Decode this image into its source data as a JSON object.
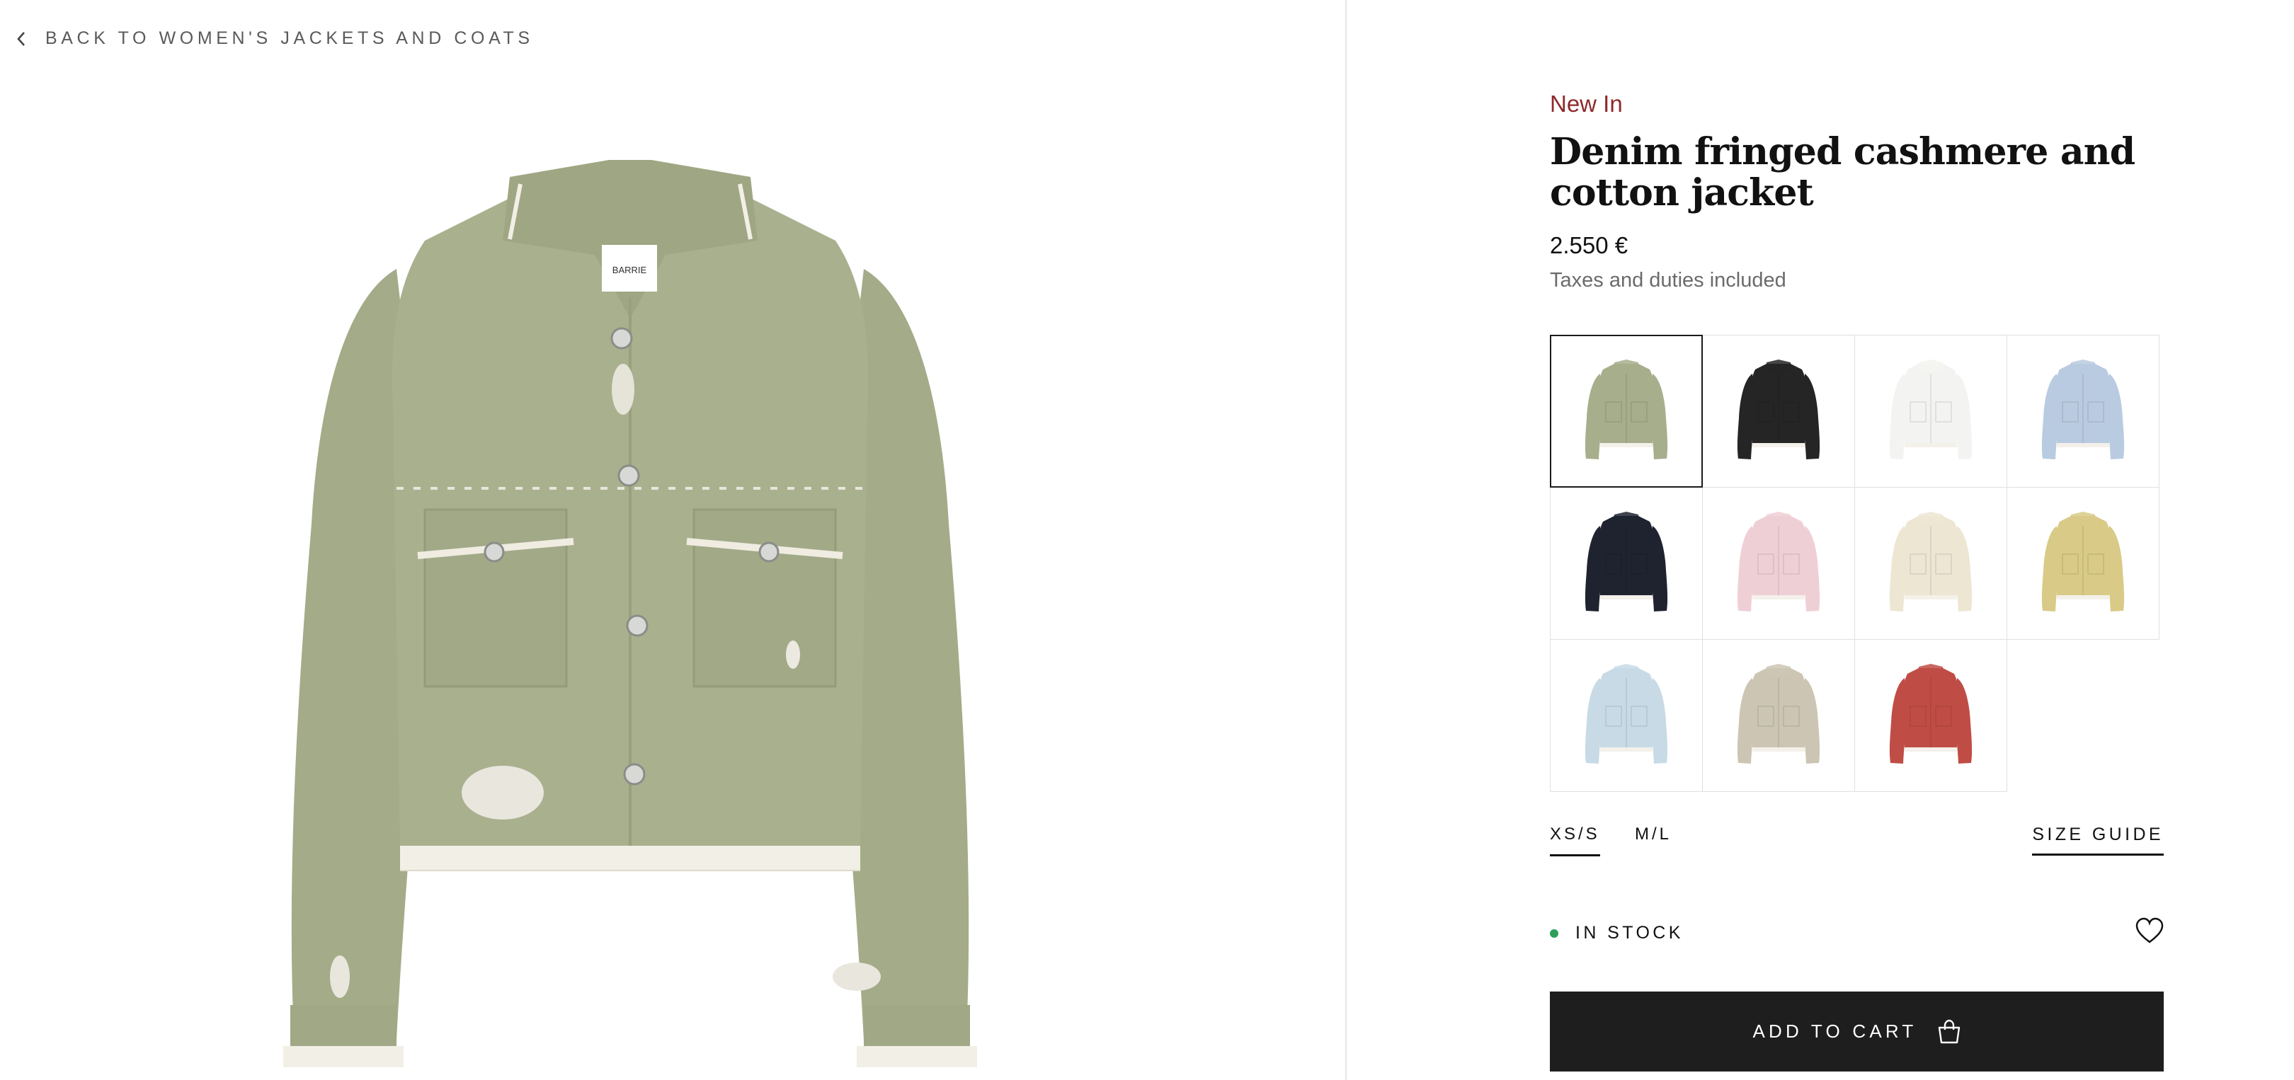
{
  "nav": {
    "back_label": "BACK TO WOMEN'S JACKETS AND COATS",
    "back_icon": "chevron-left-icon"
  },
  "product": {
    "badge": "New In",
    "title": "Denim fringed cashmere and cotton jacket",
    "price": "2.550 €",
    "tax_note": "Taxes and duties included",
    "brand_label": "BARRIE",
    "image_color": "#a7ae8c"
  },
  "swatches": [
    {
      "color": "#a7ae8c",
      "selected": true
    },
    {
      "color": "#252526",
      "selected": false
    },
    {
      "color": "#f3f3f1",
      "selected": false
    },
    {
      "color": "#b9cbe0",
      "selected": false
    },
    {
      "color": "#1f2330",
      "selected": false
    },
    {
      "color": "#efcfd6",
      "selected": false
    },
    {
      "color": "#ede6d3",
      "selected": false
    },
    {
      "color": "#d9ca87",
      "selected": false
    },
    {
      "color": "#c7dae6",
      "selected": false
    },
    {
      "color": "#ccc5b4",
      "selected": false
    },
    {
      "color": "#bf4d45",
      "selected": false
    }
  ],
  "sizes": {
    "options": [
      {
        "label": "XS/S",
        "active": true
      },
      {
        "label": "M/L",
        "active": false
      }
    ],
    "guide_label": "SIZE GUIDE"
  },
  "stock": {
    "label": "IN STOCK",
    "status_color": "#2e9f5b"
  },
  "cart": {
    "button_label": "ADD TO CART",
    "icon": "shopping-bag-icon",
    "background": "#1e1e1e"
  },
  "wishlist": {
    "icon": "heart-icon"
  },
  "colors": {
    "accent_badge": "#8e2a2a",
    "divider": "#e6e6e6"
  }
}
